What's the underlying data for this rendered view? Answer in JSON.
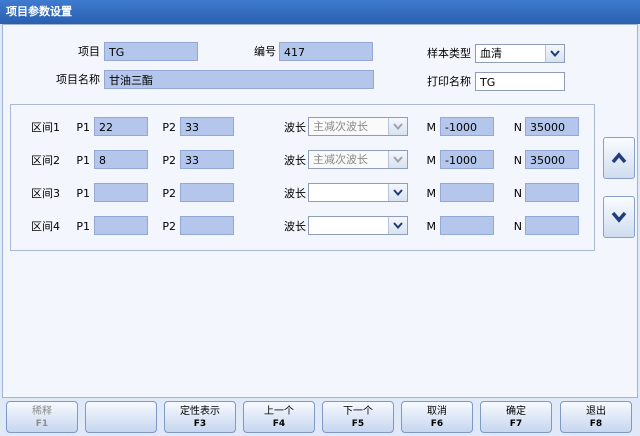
{
  "window": {
    "title": "项目参数设置"
  },
  "header": {
    "item_label": "项目",
    "item_value": "TG",
    "code_label": "编号",
    "code_value": "417",
    "sample_type_label": "样本类型",
    "sample_type_value": "血清",
    "item_name_label": "项目名称",
    "item_name_value": "甘油三酯",
    "print_name_label": "打印名称",
    "print_name_value": "TG"
  },
  "intervals": {
    "p1_label": "P1",
    "p2_label": "P2",
    "wave_label": "波长",
    "m_label": "M",
    "n_label": "N",
    "rows": [
      {
        "label": "区间1",
        "p1": "22",
        "p2": "33",
        "wave": "主减次波长",
        "m": "-1000",
        "n": "35000"
      },
      {
        "label": "区间2",
        "p1": "8",
        "p2": "33",
        "wave": "主减次波长",
        "m": "-1000",
        "n": "35000"
      },
      {
        "label": "区间3",
        "p1": "",
        "p2": "",
        "wave": "",
        "m": "",
        "n": ""
      },
      {
        "label": "区间4",
        "p1": "",
        "p2": "",
        "wave": "",
        "m": "",
        "n": ""
      }
    ]
  },
  "footer": {
    "buttons": [
      {
        "label": "稀释",
        "key": "F1"
      },
      {
        "label": "",
        "key": ""
      },
      {
        "label": "定性表示",
        "key": "F3"
      },
      {
        "label": "上一个",
        "key": "F4"
      },
      {
        "label": "下一个",
        "key": "F5"
      },
      {
        "label": "取消",
        "key": "F6"
      },
      {
        "label": "确定",
        "key": "F7"
      },
      {
        "label": "退出",
        "key": "F8"
      }
    ]
  }
}
